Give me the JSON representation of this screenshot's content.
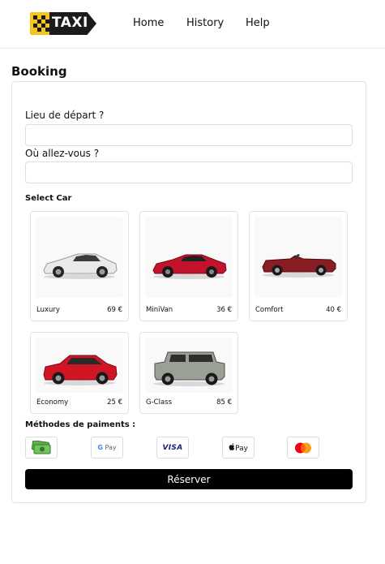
{
  "header": {
    "logo_text": "TAXI",
    "nav": [
      {
        "label": "Home"
      },
      {
        "label": "History"
      },
      {
        "label": "Help"
      }
    ]
  },
  "booking": {
    "title": "Booking",
    "departure_label": "Lieu de départ ?",
    "departure_value": "",
    "destination_label": "Où allez-vous ?",
    "destination_value": "",
    "select_car_label": "Select Car",
    "cars": [
      {
        "name": "Luxury",
        "price": "69 €",
        "color": "#e9e9e9",
        "icon": "sports-car-icon"
      },
      {
        "name": "MiniVan",
        "price": "36 €",
        "color": "#c3122b",
        "icon": "sports-car-icon"
      },
      {
        "name": "Comfort",
        "price": "40 €",
        "color": "#8a1c24",
        "icon": "convertible-car-icon"
      },
      {
        "name": "Economy",
        "price": "25 €",
        "color": "#d01525",
        "icon": "suv-car-icon"
      },
      {
        "name": "G-Class",
        "price": "85 €",
        "color": "#9aa095",
        "icon": "offroad-car-icon"
      }
    ],
    "payment_label": "Méthodes de paiments :",
    "payments": [
      {
        "name": "cash",
        "icon": "cash-icon"
      },
      {
        "name": "G Pay",
        "icon": "google-pay-icon"
      },
      {
        "name": "VISA",
        "icon": "visa-icon"
      },
      {
        "name": "Pay",
        "icon": "apple-pay-icon"
      },
      {
        "name": "mastercard",
        "icon": "mastercard-icon"
      }
    ],
    "reserve_label": "Réserver"
  },
  "colors": {
    "accent": "#000000",
    "logo_yellow": "#f5c518",
    "border": "#e2e2e2"
  }
}
